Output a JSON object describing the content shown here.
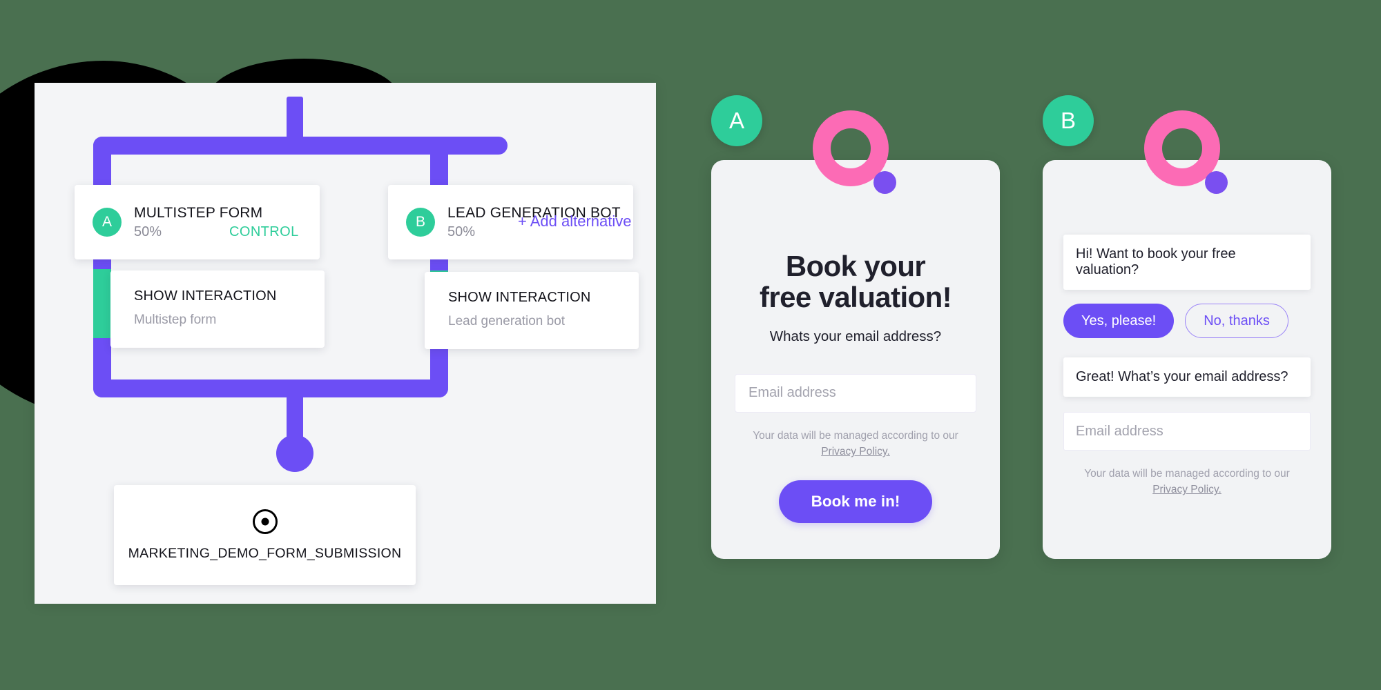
{
  "theme": {
    "background": "#4a7050",
    "purple": "#6c4ef5",
    "green": "#2ecd9a",
    "pink": "#fc6bb5",
    "panel": "#f4f5f7"
  },
  "flow": {
    "add_alternative_label": "+ Add alternative",
    "variants": [
      {
        "badge": "A",
        "title": "MULTISTEP FORM",
        "percent": "50%",
        "tag": "CONTROL",
        "action_title": "SHOW INTERACTION",
        "action_sub": "Multistep form"
      },
      {
        "badge": "B",
        "title": "LEAD GENERATION BOT",
        "percent": "50%",
        "tag": "",
        "action_title": "SHOW INTERACTION",
        "action_sub": "Lead generation bot"
      }
    ],
    "goal": {
      "icon": "target-icon",
      "label": "MARKETING_DEMO_FORM_SUBMISSION"
    }
  },
  "preview_a": {
    "badge": "A",
    "logo": "pink-ring-logo",
    "headline_line1": "Book your",
    "headline_line2": "free valuation!",
    "subhead": "Whats your email address?",
    "email_placeholder": "Email address",
    "privacy_text": "Your data will be managed according to our",
    "privacy_link": "Privacy Policy.",
    "cta_label": "Book me in!"
  },
  "preview_b": {
    "badge": "B",
    "logo": "pink-ring-logo",
    "bubble1": "Hi! Want to book your free valuation?",
    "choice_yes": "Yes, please!",
    "choice_no": "No, thanks",
    "bubble2": "Great! What’s your email address?",
    "email_placeholder": "Email address",
    "privacy_text": "Your data will be managed according to our",
    "privacy_link": "Privacy Policy."
  }
}
